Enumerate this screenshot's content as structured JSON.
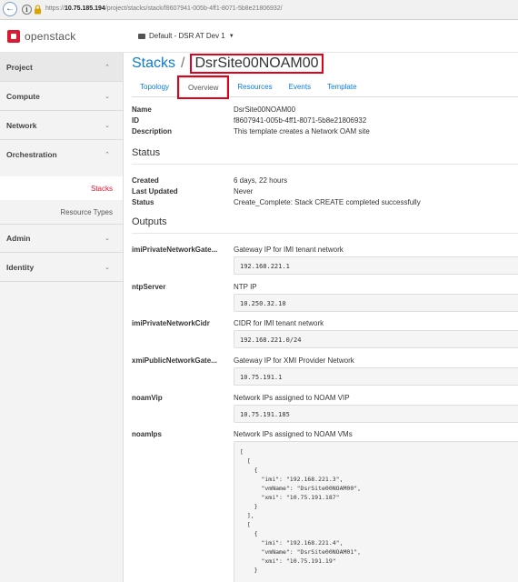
{
  "browser": {
    "url_prefix": "https://",
    "url_host": "10.75.185.194",
    "url_path": "/project/stacks/stack/f8607941-005b-4ff1-8071-5b8e21806932/"
  },
  "header": {
    "brand": "openstack",
    "project_picker": "Default - DSR AT Dev 1"
  },
  "sidebar": {
    "project": "Project",
    "compute": "Compute",
    "network": "Network",
    "orchestration": "Orchestration",
    "stacks": "Stacks",
    "resource_types": "Resource Types",
    "admin": "Admin",
    "identity": "Identity"
  },
  "page": {
    "breadcrumb": "Stacks",
    "separator": "/",
    "stack_name": "DsrSite00NOAM00"
  },
  "tabs": [
    "Topology",
    "Overview",
    "Resources",
    "Events",
    "Template"
  ],
  "details": {
    "name_label": "Name",
    "name": "DsrSite00NOAM00",
    "id_label": "ID",
    "id": "f8607941-005b-4ff1-8071-5b8e21806932",
    "description_label": "Description",
    "description": "This template creates a Network OAM site"
  },
  "status": {
    "title": "Status",
    "created_label": "Created",
    "created": "6 days, 22 hours",
    "last_updated_label": "Last Updated",
    "last_updated": "Never",
    "status_label": "Status",
    "status": "Create_Complete: Stack CREATE completed successfully"
  },
  "outputs": {
    "title": "Outputs",
    "items": [
      {
        "key": "imiPrivateNetworkGate...",
        "desc": "Gateway IP for IMI tenant network",
        "value": "192.168.221.1"
      },
      {
        "key": "ntpServer",
        "desc": "NTP IP",
        "value": "10.250.32.10"
      },
      {
        "key": "imiPrivateNetworkCidr",
        "desc": "CIDR for IMI tenant network",
        "value": "192.168.221.0/24"
      },
      {
        "key": "xmiPublicNetworkGate...",
        "desc": "Gateway IP for XMI Provider Network",
        "value": "10.75.191.1"
      },
      {
        "key": "noamVip",
        "desc": "Network IPs assigned to NOAM VIP",
        "value": "10.75.191.185"
      }
    ],
    "noam_ips": {
      "key": "noamIps",
      "desc": "Network IPs assigned to NOAM VMs",
      "value": "[\n  [\n    {\n      \"imi\": \"192.168.221.3\",\n      \"vmName\": \"DsrSite00NOAM00\",\n      \"xmi\": \"10.75.191.187\"\n    }\n  ],\n  [\n    {\n      \"imi\": \"192.168.221.4\",\n      \"vmName\": \"DsrSite00NOAM01\",\n      \"xmi\": \"10.75.191.19\"\n    }"
    }
  }
}
